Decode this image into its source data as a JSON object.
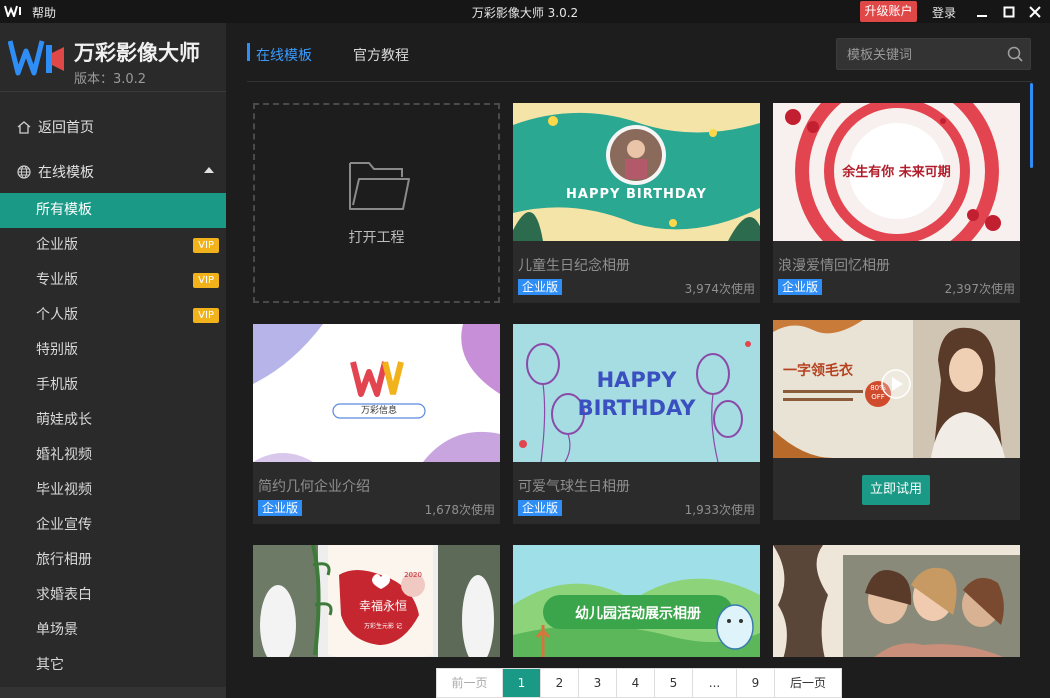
{
  "titlebar": {
    "help": "帮助",
    "title": "万彩影像大师 3.0.2",
    "upgrade": "升级账户",
    "login": "登录"
  },
  "brand": {
    "name": "万彩影像大师",
    "version": "版本：3.0.2",
    "colors": {
      "blue": "#2f8ef6",
      "red": "#e04848",
      "orange": "#f2b21c"
    }
  },
  "sidebar": {
    "home": "返回首页",
    "online": "在线模板",
    "categories": [
      {
        "label": "所有模板",
        "vip": ""
      },
      {
        "label": "企业版",
        "vip": "VIP"
      },
      {
        "label": "专业版",
        "vip": "VIP"
      },
      {
        "label": "个人版",
        "vip": "VIP"
      },
      {
        "label": "特别版",
        "vip": ""
      },
      {
        "label": "手机版",
        "vip": ""
      },
      {
        "label": "萌娃成长",
        "vip": ""
      },
      {
        "label": "婚礼视频",
        "vip": ""
      },
      {
        "label": "毕业视频",
        "vip": ""
      },
      {
        "label": "企业宣传",
        "vip": ""
      },
      {
        "label": "旅行相册",
        "vip": ""
      },
      {
        "label": "求婚表白",
        "vip": ""
      },
      {
        "label": "单场景",
        "vip": ""
      },
      {
        "label": "其它",
        "vip": ""
      }
    ]
  },
  "tabs": {
    "online": "在线模板",
    "tutorial": "官方教程"
  },
  "search": {
    "placeholder": "模板关键词"
  },
  "open_project": "打开工程",
  "cards": [
    {
      "title": "儿童生日纪念相册",
      "badge": "企业版",
      "uses": "3,974次使用",
      "thumb_text": "HAPPY BIRTHDAY"
    },
    {
      "title": "浪漫爱情回忆相册",
      "badge": "企业版",
      "uses": "2,397次使用",
      "thumb_text": "余生有你 未来可期"
    },
    {
      "title": "简约几何企业介绍",
      "badge": "企业版",
      "uses": "1,678次使用",
      "thumb_text": "万彩信息"
    },
    {
      "title": "可爱气球生日相册",
      "badge": "企业版",
      "uses": "1,933次使用",
      "thumb_text_1": "HAPPY",
      "thumb_text_2": "BIRTHDAY"
    },
    {
      "try_label": "立即试用",
      "thumb_text": "一字领毛衣",
      "sale": "80%",
      "sale_off": "OFF"
    },
    {
      "thumb_text": "幸福永恒",
      "thumb_year": "2020",
      "thumb_sub": "万彩生元影 记"
    },
    {
      "thumb_text": "幼儿园活动展示相册"
    },
    {}
  ],
  "pagination": {
    "prev": "前一页",
    "pages": [
      "1",
      "2",
      "3",
      "4",
      "5",
      "...",
      "9"
    ],
    "next": "后一页",
    "current": "1"
  }
}
